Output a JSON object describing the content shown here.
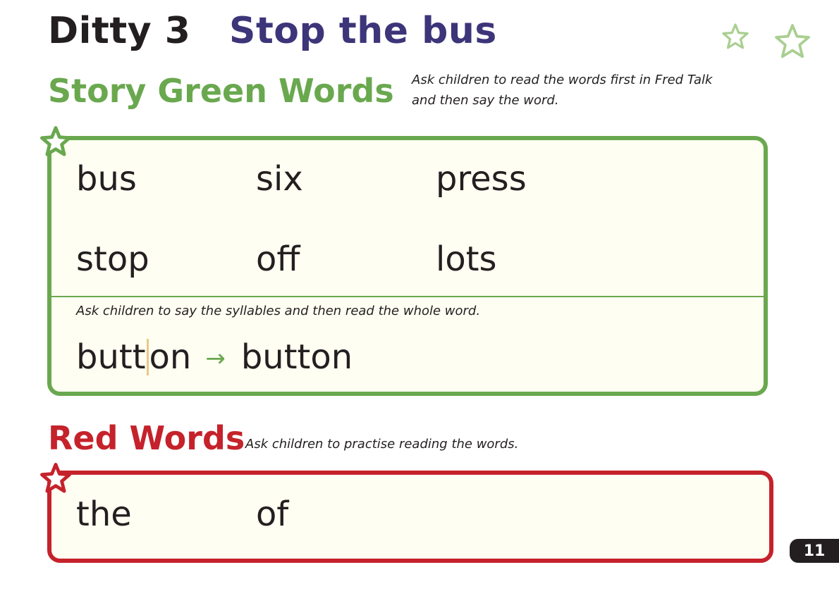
{
  "title": {
    "ditty": "Ditty 3",
    "story": "Stop the bus"
  },
  "green_words": {
    "heading": "Story Green Words",
    "instruction": "Ask children to read the words first in Fred Talk and then say the word.",
    "row1": [
      "bus",
      "six",
      "press"
    ],
    "row2": [
      "stop",
      "off",
      "lots"
    ],
    "syllable_instruction": "Ask children to say the syllables and then read the whole word.",
    "syllable_part1": "butt",
    "syllable_part2": "on",
    "arrow": "→",
    "whole_word": "button"
  },
  "red_words": {
    "heading": "Red Words",
    "instruction": "Ask children to practise reading the words.",
    "words": [
      "the",
      "of"
    ]
  },
  "page_number": "11",
  "colors": {
    "green": "#6aa84f",
    "red": "#c5222b",
    "purple": "#3d3579",
    "box_fill": "#fefef2"
  },
  "icons": [
    "star-icon"
  ]
}
